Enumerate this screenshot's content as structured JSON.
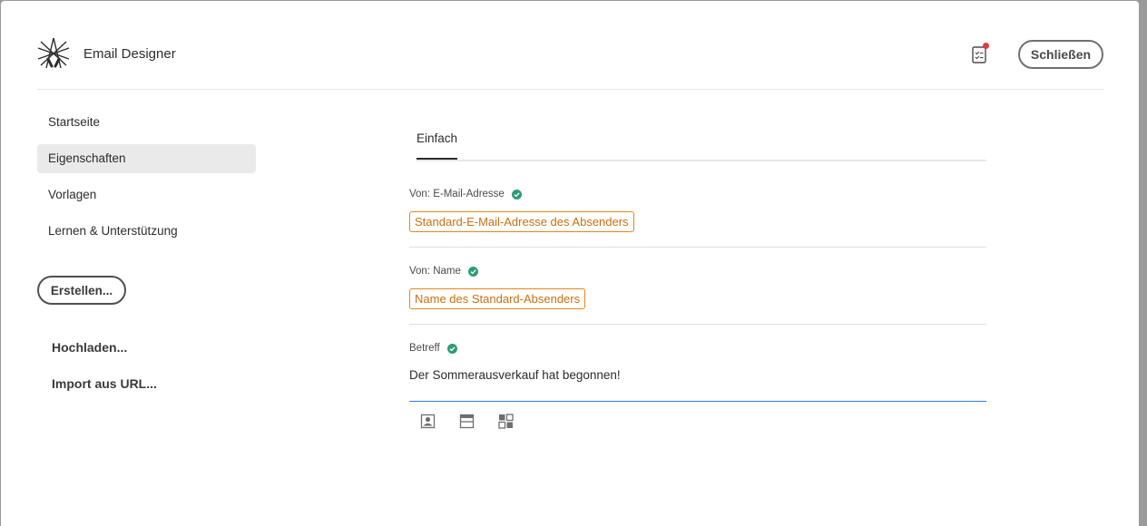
{
  "app": {
    "title": "Email Designer",
    "close_label": "Schließen"
  },
  "nav": {
    "items": [
      {
        "label": "Startseite"
      },
      {
        "label": "Eigenschaften",
        "active": true
      },
      {
        "label": "Vorlagen"
      },
      {
        "label": "Lernen & Unterstützung"
      }
    ],
    "create_label": "Erstellen...",
    "upload_label": "Hochladen...",
    "import_label": "Import aus URL..."
  },
  "tabs": [
    {
      "label": "Einfach",
      "active": true
    }
  ],
  "fields": {
    "from_email": {
      "label": "Von: E-Mail-Adresse",
      "token": "Standard-E-Mail-Adresse des Absenders"
    },
    "from_name": {
      "label": "Von: Name",
      "token": "Name des Standard-Absenders"
    },
    "subject": {
      "label": "Betreff",
      "value": "Der Sommerausverkauf hat begonnen!"
    }
  },
  "colors": {
    "accent_blue": "#2680eb",
    "token_orange": "#e68619",
    "valid_green": "#2d9d78",
    "notification_red": "#e03c3c"
  },
  "icons": [
    "email-designer-logo-icon",
    "checklist-icon",
    "valid-check-icon",
    "personalization-icon",
    "content-block-icon",
    "dynamic-content-icon"
  ]
}
